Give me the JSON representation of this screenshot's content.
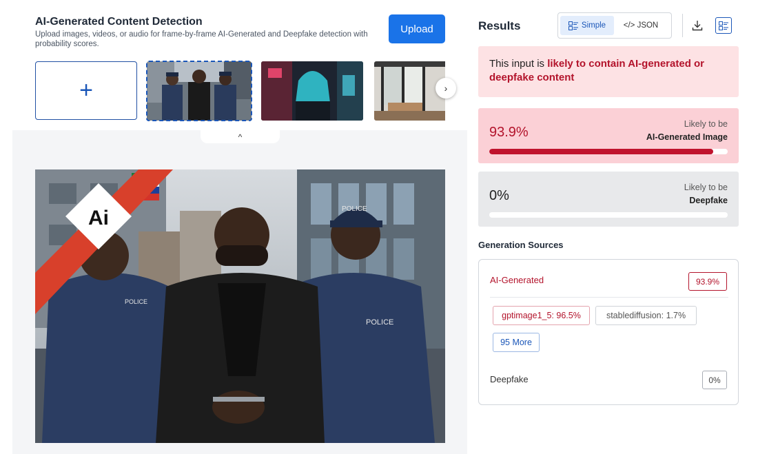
{
  "header": {
    "title": "AI-Generated Content Detection",
    "description": "Upload images, videos, or audio for frame-by-frame AI-Generated and Deepfake detection with probability scores.",
    "upload_label": "Upload"
  },
  "gallery": {
    "add_symbol": "+",
    "next_symbol": "›",
    "collapse_symbol": "^"
  },
  "preview": {
    "watermark_text": "Ai",
    "badge_text_1": "POLICE",
    "badge_text_2": "POLICE",
    "badge_text_3": "POLICE"
  },
  "results": {
    "title": "Results",
    "toggle_simple": "Simple",
    "toggle_json": "</> JSON",
    "verdict_prefix": "This input is ",
    "verdict_strong": "likely to contain AI-generated or deepfake content",
    "ai_score": {
      "percent_text": "93.9%",
      "value": 0.939,
      "label_top": "Likely to be",
      "label_bottom": "AI-Generated Image"
    },
    "deepfake_score": {
      "percent_text": "0%",
      "value": 0,
      "label_top": "Likely to be",
      "label_bottom": "Deepfake"
    }
  },
  "generation_sources": {
    "title": "Generation Sources",
    "ai_label": "AI-Generated",
    "ai_badge": "93.9%",
    "chips": [
      "gptimage1_5: 96.5%",
      "stablediffusion: 1.7%"
    ],
    "more_label": "95 More",
    "deepfake_label": "Deepfake",
    "deepfake_badge": "0%"
  },
  "colors": {
    "accent_blue": "#1a73e8",
    "danger_red": "#b3132b",
    "ai_score_bg": "#fbd0d6",
    "verdict_bg": "#fde2e4"
  }
}
